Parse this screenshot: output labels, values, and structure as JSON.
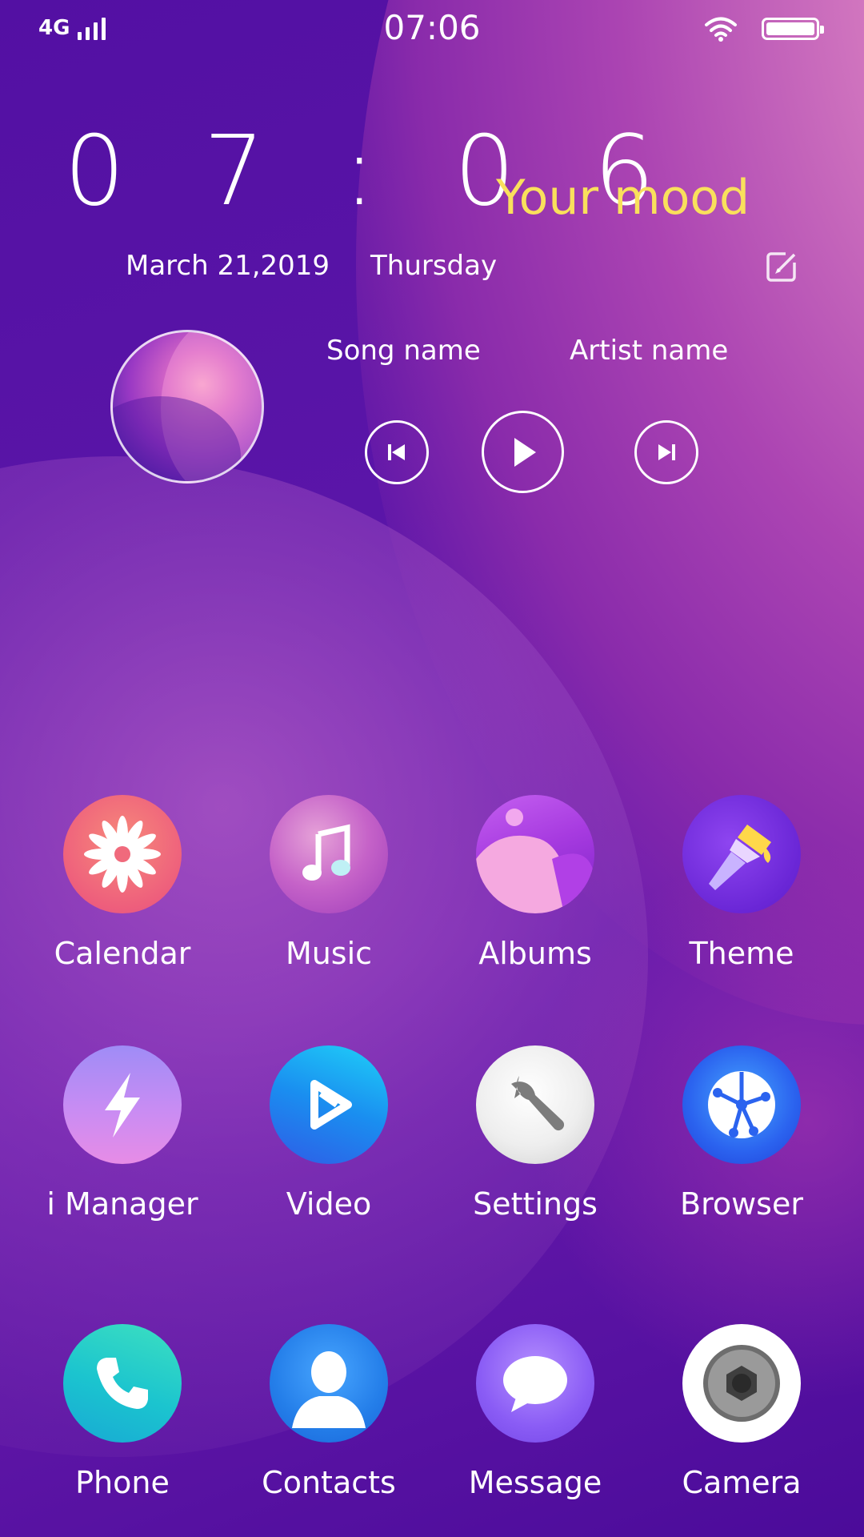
{
  "status_bar": {
    "network": "4G",
    "time": "07:06"
  },
  "clock_widget": {
    "time": "0 7 : 0 6",
    "mood": "Your mood",
    "date": "March 21,2019",
    "weekday": "Thursday"
  },
  "music_widget": {
    "song": "Song name",
    "artist": "Artist name"
  },
  "apps": {
    "row1": [
      "Calendar",
      "Music",
      "Albums",
      "Theme"
    ],
    "row2": [
      "i Manager",
      "Video",
      "Settings",
      "Browser"
    ],
    "dock": [
      "Phone",
      "Contacts",
      "Message",
      "Camera"
    ]
  },
  "colors": {
    "mood_text": "#f9e05c",
    "background": "#4a0c9a"
  }
}
